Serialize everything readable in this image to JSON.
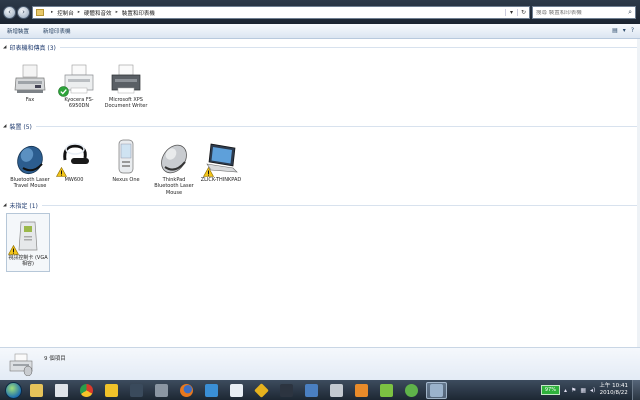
{
  "window": {
    "breadcrumbs": [
      "控制台",
      "硬體和音效",
      "裝置和印表機"
    ],
    "search_placeholder": "搜尋 裝置和印表機"
  },
  "toolbar": {
    "add_device": "新增裝置",
    "add_printer": "新增印表機"
  },
  "groups": [
    {
      "title": "印表機和傳真 (3)",
      "items": [
        {
          "label": "Fax",
          "icon": "fax-icon",
          "badge": ""
        },
        {
          "label": "Kyocera FS-6950DN",
          "icon": "printer-icon",
          "badge": "default-check"
        },
        {
          "label": "Microsoft XPS Document Writer",
          "icon": "printer-icon",
          "badge": ""
        }
      ]
    },
    {
      "title": "裝置 (5)",
      "items": [
        {
          "label": "Bluetooth Laser Travel Mouse",
          "icon": "blue-mouse-icon",
          "badge": ""
        },
        {
          "label": "MW600",
          "icon": "headset-icon",
          "badge": "warning"
        },
        {
          "label": "Nexus One",
          "icon": "phone-icon",
          "badge": ""
        },
        {
          "label": "ThinkPad Bluetooth Laser Mouse",
          "icon": "silver-mouse-icon",
          "badge": ""
        },
        {
          "label": "ZLICK-THINKPAD",
          "icon": "laptop-icon",
          "badge": "warning"
        }
      ]
    },
    {
      "title": "未指定 (1)",
      "items": [
        {
          "label": "視訊控制卡 (VGA 相容)",
          "icon": "computer-box-icon",
          "badge": "warning"
        }
      ]
    }
  ],
  "details": {
    "count_text": "9 個項目"
  },
  "taskbar": {
    "battery": "97%",
    "time": "上午 10:41",
    "date": "2010/8/22"
  },
  "colors": {
    "accent": "#1e395b",
    "battery": "#2fb23c",
    "warning": "#f2c418"
  }
}
